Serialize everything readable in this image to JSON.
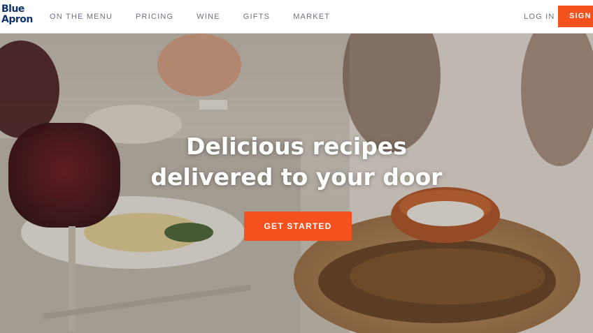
{
  "brand": {
    "line1": "Blue",
    "line2": "Apron",
    "color": "#0f346c"
  },
  "nav": {
    "items": [
      {
        "label": "ON THE MENU"
      },
      {
        "label": "PRICING"
      },
      {
        "label": "WINE"
      },
      {
        "label": "GIFTS"
      },
      {
        "label": "MARKET"
      }
    ],
    "login_label": "LOG IN",
    "signup_label": "SIGN UP"
  },
  "hero": {
    "headline_line1": "Delicious recipes",
    "headline_line2": "delivered to your door",
    "cta_label": "GET STARTED",
    "accent_color": "#f4511e"
  }
}
